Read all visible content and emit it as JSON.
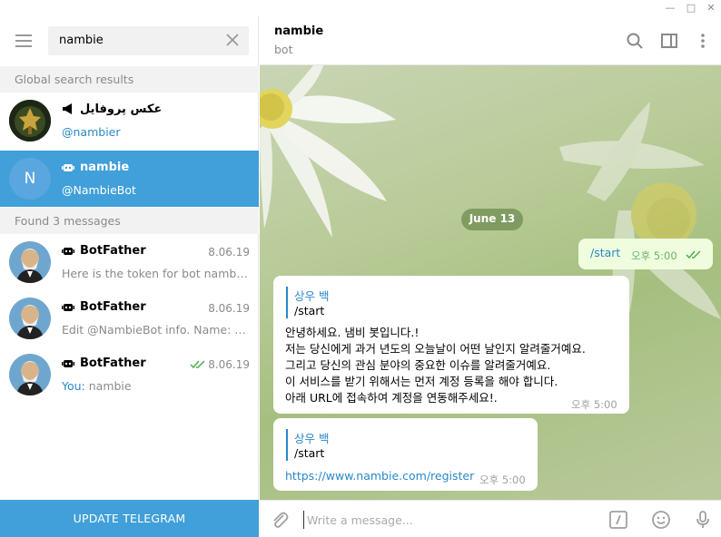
{
  "search": {
    "value": "nambie"
  },
  "sections": {
    "global": "Global search results",
    "found": "Found 3 messages"
  },
  "global_results": [
    {
      "name": "عکس پروفایل",
      "username": "@nambier",
      "icon": "megaphone-icon"
    },
    {
      "name": "nambie",
      "username": "@NambieBot",
      "avatar_letter": "N",
      "icon": "bot-icon",
      "selected": true
    }
  ],
  "messages_found": [
    {
      "name": "BotFather",
      "date": "8.06.19",
      "preview": "Here is the token for bot nambie ..."
    },
    {
      "name": "BotFather",
      "date": "8.06.19",
      "preview": "Edit @NambieBot info.  Name: na..."
    },
    {
      "name": "BotFather",
      "date": "8.06.19",
      "prefix": "You:",
      "preview": " nambie",
      "read": true
    }
  ],
  "update_button": "UPDATE TELEGRAM",
  "chat": {
    "title": "nambie",
    "status": "bot",
    "date_pill": "June 13",
    "outgoing": {
      "text": "/start",
      "time": "오후 5:00"
    },
    "reply1": {
      "reply_name": "상우 백",
      "reply_text": "/start",
      "lines": [
        "안녕하세요. 냄비 봇입니다.!",
        "저는 당신에게 과거 년도의 오늘날이 어떤 날인지 알려줄거예요.",
        "그리고 당신의 관심 분야의 중요한 이슈를 알려줄거예요.",
        "이 서비스를 받기 위해서는 먼저 계정 등록을 해야 합니다.",
        "아래 URL에 접속하여 계정을 연동해주세요!."
      ],
      "time": "오후 5:00"
    },
    "reply2": {
      "reply_name": "상우 백",
      "reply_text": "/start",
      "link": "https://www.nambie.com/register",
      "time": "오후 5:00"
    }
  },
  "composer": {
    "placeholder": "Write a message..."
  },
  "colors": {
    "accent": "#419fd9",
    "link": "#2a88c7",
    "outgoing_bubble": "#effdde"
  }
}
